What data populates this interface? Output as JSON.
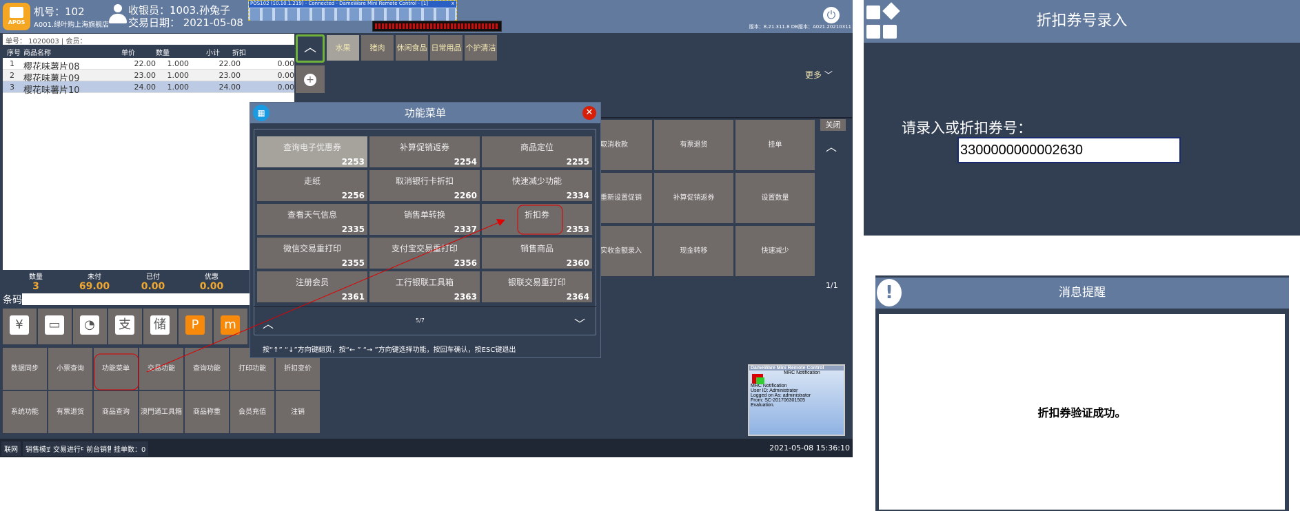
{
  "header": {
    "logo_text": "APOS",
    "machine": "机号：102",
    "store": "A001.绿叶购上海旗舰店",
    "cashier": "收银员：1003.孙兔子",
    "date": "交易日期：  2021-05-08",
    "version": "版本：8.21.311.8 DB版本：A021.20210311"
  },
  "remote": {
    "title": "POS102 (10.10.1.219) - Connected - DameWare Mini Remote Control - [1]",
    "close": "x"
  },
  "order": {
    "label": "单号：  1020003   | 会员："
  },
  "table": {
    "headers": [
      "序号",
      "商品名称",
      "单价",
      "数量",
      "小计",
      "折扣"
    ],
    "rows": [
      [
        "1",
        "樱花味薯片08",
        "22.00",
        "1.000",
        "22.00",
        "0.00"
      ],
      [
        "2",
        "樱花味薯片09",
        "23.00",
        "1.000",
        "23.00",
        "0.00"
      ],
      [
        "3",
        "樱花味薯片10",
        "24.00",
        "1.000",
        "24.00",
        "0.00"
      ]
    ]
  },
  "summary": [
    {
      "label": "数量",
      "value": "3"
    },
    {
      "label": "未付",
      "value": "69.00"
    },
    {
      "label": "已付",
      "value": "0.00"
    },
    {
      "label": "优惠",
      "value": "0.00"
    }
  ],
  "barcode": {
    "label": "条码",
    "value": ""
  },
  "payments": [
    "¥",
    "▭",
    "◔",
    "支",
    "储",
    "P",
    "m"
  ],
  "functions": [
    "数据同步",
    "小票查询",
    "功能菜单",
    "交易功能",
    "查询功能",
    "打印功能",
    "折扣变价",
    "系统功能",
    "有票退货",
    "商品查询",
    "澳門通工具箱",
    "商品称重",
    "会员充值",
    "注销"
  ],
  "status": [
    "联网",
    "销售模式",
    "交易进行中",
    "前台销售",
    "挂单数：0"
  ],
  "clock": "2021-05-08 15:36:10",
  "categories": [
    "水果",
    "猪肉",
    "休闲食品",
    "日常用品",
    "个护清洁"
  ],
  "more": "更多",
  "right_grid": [
    "取消收款",
    "有票退货",
    "挂单",
    "重新设置促销",
    "补算促销返券",
    "设置数量",
    "实收金额录入",
    "现金转移",
    "快速减少"
  ],
  "close_label": "关闭",
  "right_page": "1/1",
  "menu": {
    "title": "功能菜单",
    "page": "5/7",
    "hint": "按“↑” “↓”方向键翻页，按“← ” “→ ”方向键选择功能，按回车确认，按ESC键退出",
    "items": [
      [
        "查询电子优惠券",
        "2253"
      ],
      [
        "补算促销返券",
        "2254"
      ],
      [
        "商品定位",
        "2255"
      ],
      [
        "走纸",
        "2256"
      ],
      [
        "取消银行卡折扣",
        "2260"
      ],
      [
        "快速减少功能",
        "2334"
      ],
      [
        "查看天气信息",
        "2335"
      ],
      [
        "销售单转换",
        "2337"
      ],
      [
        "折扣券",
        "2353"
      ],
      [
        "微信交易重打印",
        "2355"
      ],
      [
        "支付宝交易重打印",
        "2356"
      ],
      [
        "销售商品",
        "2360"
      ],
      [
        "注册会员",
        "2361"
      ],
      [
        "工行银联工具箱",
        "2363"
      ],
      [
        "银联交易重打印",
        "2364"
      ]
    ]
  },
  "mrc": {
    "title": "DameWare Mini Remote Control",
    "heading": "MRC Notification",
    "lines": [
      "MRC Notification",
      "User ID: Administrator",
      "Logged on As: administrator",
      "From: SC-201706301505",
      "Evaluation."
    ]
  },
  "coupon_dialog": {
    "title": "折扣券号录入",
    "prompt": "请录入或折扣券号：",
    "value": "3300000000002630"
  },
  "message_dialog": {
    "title": "消息提醒",
    "message": "折扣券验证成功。"
  },
  "colors": {
    "titlebar": "#627a9e",
    "panel": "#323e52",
    "button": "#706a68",
    "accent": "#f0a830",
    "annotation": "#e00000"
  }
}
